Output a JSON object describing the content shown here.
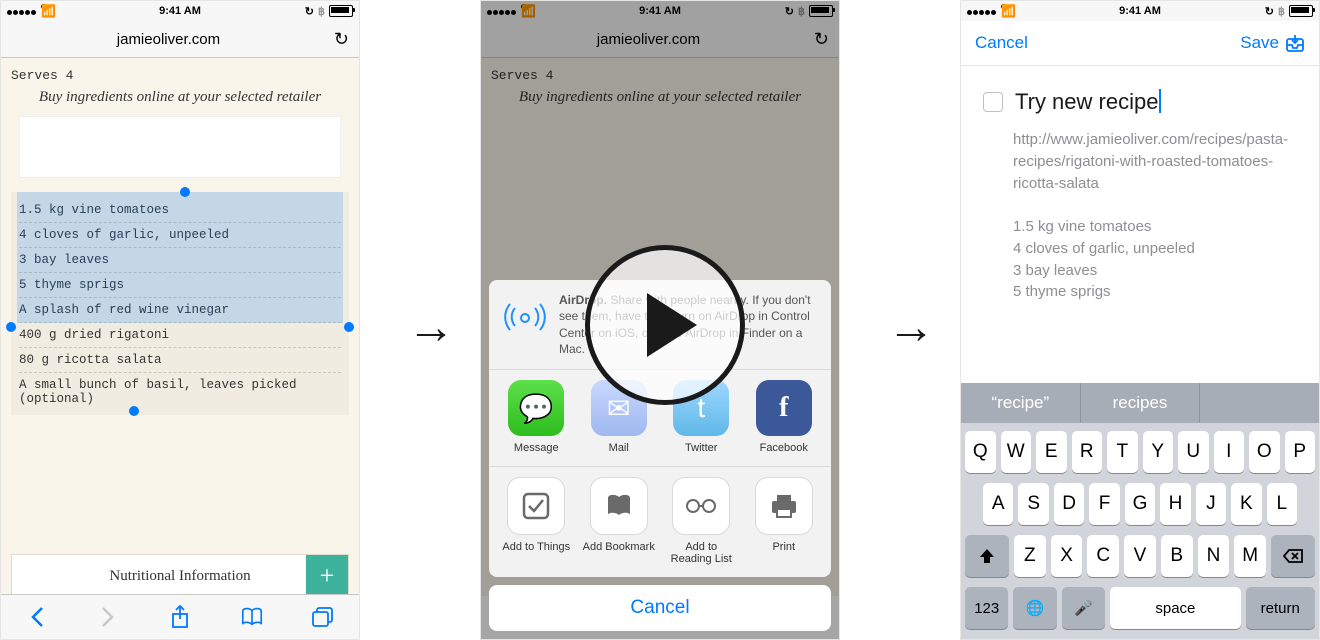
{
  "status": {
    "time": "9:41 AM"
  },
  "safari": {
    "url": "jamieoliver.com",
    "serves": "Serves 4",
    "buy": "Buy ingredients online at your selected retailer",
    "ingredients": [
      "1.5 kg vine tomatoes",
      "4 cloves of garlic, unpeeled",
      "3 bay leaves",
      "5 thyme sprigs",
      "A splash of red wine vinegar",
      "400 g dried rigatoni",
      "80 g ricotta salata",
      "A small bunch of basil, leaves picked (optional)"
    ],
    "nutri": "Nutritional Information"
  },
  "share": {
    "airdrop_title": "AirDrop.",
    "airdrop_text": " Share with people nearby. If you don't see them, have them turn on AirDrop in Control Center on iOS, or go to AirDrop in Finder on a Mac.",
    "apps": [
      "Message",
      "Mail",
      "Twitter",
      "Facebook"
    ],
    "actions": [
      "Add to Things",
      "Add Bookmark",
      "Add to Reading List",
      "Print"
    ],
    "cancel": "Cancel"
  },
  "things": {
    "cancel": "Cancel",
    "save": "Save",
    "title": "Try new recipe",
    "notes": "http://www.jamieoliver.com/recipes/pasta-recipes/rigatoni-with-roasted-tomatoes-ricotta-salata\n\n1.5 kg vine tomatoes\n4 cloves of garlic, unpeeled\n3 bay leaves\n5 thyme sprigs",
    "suggestions": [
      "“recipe”",
      "recipes",
      ""
    ]
  },
  "keyboard": {
    "r1": [
      "Q",
      "W",
      "E",
      "R",
      "T",
      "Y",
      "U",
      "I",
      "O",
      "P"
    ],
    "r2": [
      "A",
      "S",
      "D",
      "F",
      "G",
      "H",
      "J",
      "K",
      "L"
    ],
    "r3": [
      "Z",
      "X",
      "C",
      "V",
      "B",
      "N",
      "M"
    ],
    "num": "123",
    "space": "space",
    "return": "return"
  }
}
